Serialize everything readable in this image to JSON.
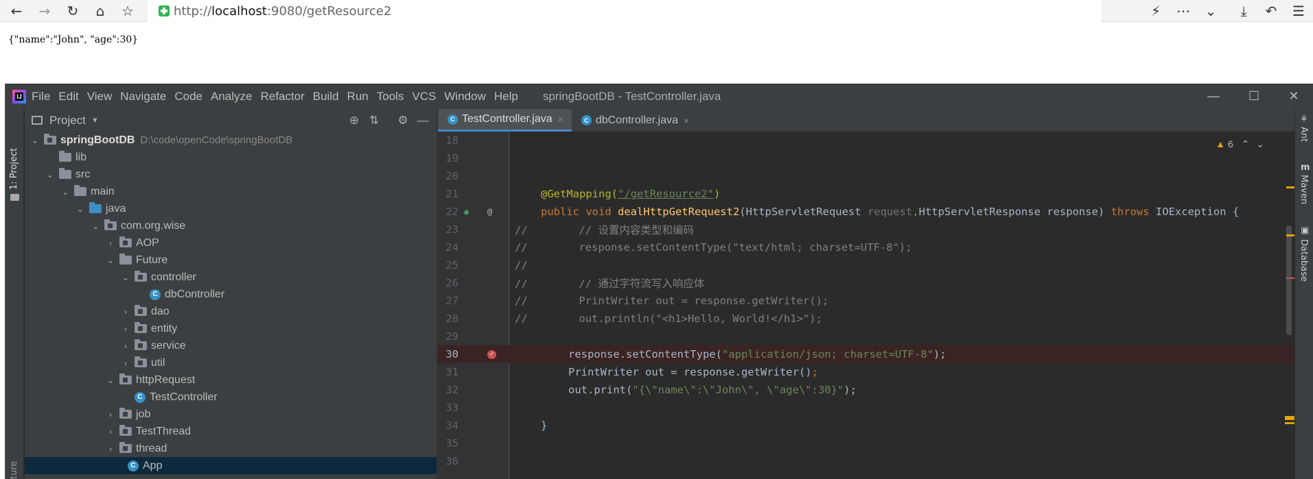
{
  "browser": {
    "url_proto": "http://",
    "url_host": "localhost",
    "url_rest": ":9080/getResource2",
    "page_text": "{\"name\":\"John\", \"age\":30}"
  },
  "ide": {
    "logo_text": "IJ",
    "menu": [
      "File",
      "Edit",
      "View",
      "Navigate",
      "Code",
      "Analyze",
      "Refactor",
      "Build",
      "Run",
      "Tools",
      "VCS",
      "Window",
      "Help"
    ],
    "title": "springBootDB - TestController.java",
    "left_strip_label": "1: Project",
    "left_strip_bottom_label": "ture",
    "project_header": "Project",
    "right_strip": [
      "Ant",
      "Maven",
      "Database"
    ],
    "warnings_count": "6"
  },
  "tree": [
    {
      "label": "springBootDB",
      "note": "D:\\code\\openCode\\springBootDB"
    },
    {
      "label": "lib"
    },
    {
      "label": "src"
    },
    {
      "label": "main"
    },
    {
      "label": "java"
    },
    {
      "label": "com.org.wise"
    },
    {
      "label": "AOP"
    },
    {
      "label": "Future"
    },
    {
      "label": "controller"
    },
    {
      "label": "dbController"
    },
    {
      "label": "dao"
    },
    {
      "label": "entity"
    },
    {
      "label": "service"
    },
    {
      "label": "util"
    },
    {
      "label": "httpRequest"
    },
    {
      "label": "TestController"
    },
    {
      "label": "job"
    },
    {
      "label": "TestThread"
    },
    {
      "label": "thread"
    },
    {
      "label": "App"
    }
  ],
  "tabs": [
    {
      "label": "TestController.java",
      "close": "×"
    },
    {
      "label": "dbController.java",
      "close": "×"
    }
  ],
  "code": {
    "lines": [
      "18",
      "19",
      "20",
      "21",
      "22",
      "23",
      "24",
      "25",
      "26",
      "27",
      "28",
      "29",
      "30",
      "31",
      "32",
      "33",
      "34",
      "35",
      "36"
    ],
    "l21": {
      "ann": "@GetMapping(",
      "str": "\"/getResource2\"",
      "end": ")"
    },
    "l22": {
      "kw1": "public void ",
      "fn": "dealHttpGetRequest2",
      "p1": "(HttpServletRequest ",
      "p1n": "request",
      "comma": ",",
      "p2": "HttpServletResponse response) ",
      "kw2": "throws ",
      "ex": "IOException {"
    },
    "l23": "//        // 设置内容类型和编码",
    "l24": "//        response.setContentType(\"text/html; charset=UTF-8\");",
    "l25": "//",
    "l26": "//        // 通过字符流写入响应体",
    "l27": "//        PrintWriter out = response.getWriter();",
    "l28": "//        out.println(\"<h1>Hello, World!</h1>\");",
    "l30": {
      "a": "response.setContentType(",
      "s": "\"application/json; charset=UTF-8\"",
      "b": ");"
    },
    "l31": {
      "a": "PrintWriter out = response.getWriter()",
      "b": ";"
    },
    "l32": {
      "a": "out.print(",
      "s": "\"{\\\"name\\\":\\\"John\\\", \\\"age\\\":30}\"",
      "b": ");"
    },
    "l34": "}"
  },
  "colors": {
    "breakpoint": "#c75450",
    "accent": "#4a88c7",
    "warning": "#e0a30b"
  }
}
